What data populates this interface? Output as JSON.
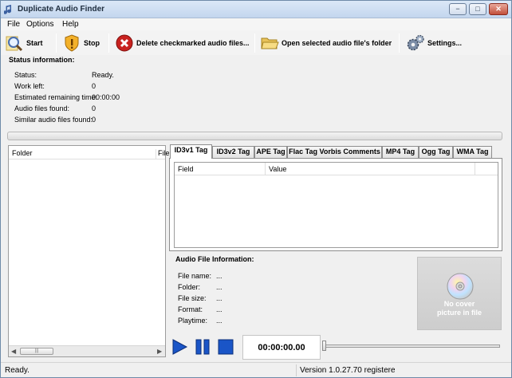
{
  "window": {
    "title": "Duplicate Audio Finder",
    "controls": {
      "minimize": "−",
      "maximize": "□",
      "close": "✕"
    }
  },
  "menu": {
    "file": "File",
    "options": "Options",
    "help": "Help"
  },
  "toolbar": {
    "start": "Start",
    "stop": "Stop",
    "delete": "Delete checkmarked audio files...",
    "open_folder": "Open selected audio file's folder",
    "settings": "Settings..."
  },
  "status": {
    "heading": "Status information:",
    "rows": [
      {
        "label": "Status:",
        "value": "Ready."
      },
      {
        "label": "Work left:",
        "value": "0"
      },
      {
        "label": "Estimated remaining time:",
        "value": "00:00:00"
      },
      {
        "label": "Audio files found:",
        "value": "0"
      },
      {
        "label": "Similar audio files found:",
        "value": "0"
      }
    ],
    "progress": 0
  },
  "folder_list": {
    "columns": [
      "Folder",
      "File"
    ]
  },
  "tabs": [
    "ID3v1 Tag",
    "ID3v2 Tag",
    "APE Tag",
    "Flac Tag Vorbis Comments",
    "MP4 Tag",
    "Ogg Tag",
    "WMA Tag"
  ],
  "active_tab": 0,
  "tag_grid": {
    "columns": [
      "Field",
      "Value"
    ]
  },
  "file_info": {
    "heading": "Audio File Information:",
    "rows": [
      {
        "label": "File name:",
        "value": "..."
      },
      {
        "label": "Folder:",
        "value": "..."
      },
      {
        "label": "File size:",
        "value": "..."
      },
      {
        "label": "Format:",
        "value": "..."
      },
      {
        "label": "Playtime:",
        "value": "..."
      }
    ]
  },
  "cover": {
    "text_line1": "No cover",
    "text_line2": "picture in file"
  },
  "player": {
    "time": "00:00:00.00",
    "position": 0
  },
  "statusbar": {
    "left": "Ready.",
    "version": "Version 1.0.27.70 registere"
  },
  "colors": {
    "accent": "#1f5fbf",
    "play": "#1a55c7"
  },
  "icons": {
    "app": "app-note-icon",
    "start": "search-magnifier-icon",
    "stop": "shield-stop-icon",
    "delete": "red-x-icon",
    "folder": "open-folder-icon",
    "settings": "gears-icon",
    "cover": "cd-disc-icon"
  }
}
